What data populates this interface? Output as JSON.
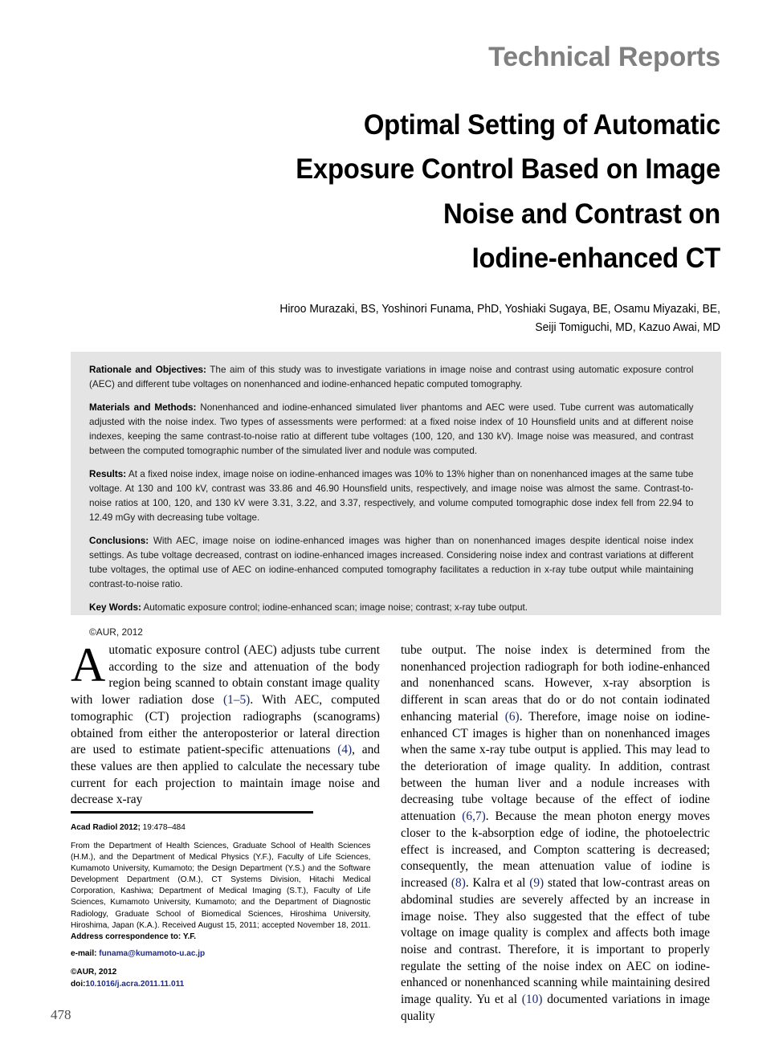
{
  "header": {
    "section_label": "Technical Reports"
  },
  "title": {
    "lines": [
      "Optimal Setting of Automatic",
      "Exposure Control Based on Image",
      "Noise and Contrast on",
      "Iodine-enhanced CT"
    ],
    "full": "Optimal Setting of Automatic Exposure Control Based on Image Noise and Contrast on Iodine-enhanced CT"
  },
  "authors": {
    "line1": "Hiroo Murazaki, BS, Yoshinori Funama, PhD, Yoshiaki Sugaya, BE, Osamu Miyazaki, BE,",
    "line2": "Seiji Tomiguchi, MD, Kazuo Awai, MD"
  },
  "abstract": {
    "rationale_label": "Rationale and Objectives:",
    "rationale_text": " The aim of this study was to investigate variations in image noise and contrast using automatic exposure control (AEC) and different tube voltages on nonenhanced and iodine-enhanced hepatic computed tomography.",
    "methods_label": "Materials and Methods:",
    "methods_text": " Nonenhanced and iodine-enhanced simulated liver phantoms and AEC were used. Tube current was automatically adjusted with the noise index. Two types of assessments were performed: at a fixed noise index of 10 Hounsfield units and at different noise indexes, keeping the same contrast-to-noise ratio at different tube voltages (100, 120, and 130 kV). Image noise was measured, and contrast between the computed tomographic number of the simulated liver and nodule was computed.",
    "results_label": "Results:",
    "results_text": " At a fixed noise index, image noise on iodine-enhanced images was 10% to 13% higher than on nonenhanced images at the same tube voltage. At 130 and 100 kV, contrast was 33.86 and 46.90 Hounsfield units, respectively, and image noise was almost the same. Contrast-to-noise ratios at 100, 120, and 130 kV were 3.31, 3.22, and 3.37, respectively, and volume computed tomographic dose index fell from 22.94 to 12.49 mGy with decreasing tube voltage.",
    "conclusions_label": "Conclusions:",
    "conclusions_text": " With AEC, image noise on iodine-enhanced images was higher than on nonenhanced images despite identical noise index settings. As tube voltage decreased, contrast on iodine-enhanced images increased. Considering noise index and contrast variations at different tube voltages, the optimal use of AEC on iodine-enhanced computed tomography facilitates a reduction in x-ray tube output while maintaining contrast-to-noise ratio.",
    "keywords_label": "Key Words:",
    "keywords_text": " Automatic exposure control; iodine-enhanced scan; image noise; contrast; x-ray tube output.",
    "copyright": "©AUR, 2012"
  },
  "body": {
    "left_dropcap": "A",
    "left_paragraph": "utomatic exposure control (AEC) adjusts tube current according to the size and attenuation of the body region being scanned to obtain constant image quality with lower radiation dose ",
    "left_ref1": "(1–5)",
    "left_paragraph_2": ". With AEC, computed tomographic (CT) projection radiographs (scanograms) obtained from either the anteroposterior or lateral direction are used to estimate patient-specific attenuations ",
    "left_ref2": "(4)",
    "left_paragraph_3": ", and these values are then applied to calculate the necessary tube current for each projection to maintain image noise and decrease x-ray",
    "right_p1": "tube output. The noise index is determined from the nonenhanced projection radiograph for both iodine-enhanced and nonenhanced scans. However, x-ray absorption is different in scan areas that do or do not contain iodinated enhancing material ",
    "right_ref1": "(6)",
    "right_p2": ". Therefore, image noise on iodine-enhanced CT images is higher than on nonenhanced images when the same x-ray tube output is applied. This may lead to the deterioration of image quality. In addition, contrast between the human liver and a nodule increases with decreasing tube voltage because of the effect of iodine attenuation ",
    "right_ref2": "(6,7)",
    "right_p3": ". Because the mean photon energy moves closer to the k-absorption edge of iodine, the photoelectric effect is increased, and Compton scattering is decreased; consequently, the mean attenuation value of iodine is increased ",
    "right_ref3": "(8)",
    "right_p4": ". Kalra et al ",
    "right_ref4": "(9)",
    "right_p5": " stated that low-contrast areas on abdominal studies are severely affected by an increase in image noise. They also suggested that the effect of tube voltage on image quality is complex and affects both image noise and contrast. Therefore, it is important to properly regulate the setting of the noise index on AEC on iodine-enhanced or nonenhanced scanning while maintaining desired image quality. Yu et al ",
    "right_ref5": "(10)",
    "right_p6": " documented variations in image quality"
  },
  "footnote": {
    "citation_bold": "Acad Radiol 2012;",
    "citation_rest": " 19:478–484",
    "affiliation": "From the Department of Health Sciences, Graduate School of Health Sciences (H.M.), and the Department of Medical Physics (Y.F.), Faculty of Life Sciences, Kumamoto University, Kumamoto; the Design Department (Y.S.) and the Software Development Department (O.M.), CT Systems Division, Hitachi Medical Corporation, Kashiwa; Department of Medical Imaging (S.T.), Faculty of Life Sciences, Kumamoto University, Kumamoto; and the Department of Diagnostic Radiology, Graduate School of Biomedical Sciences, Hiroshima University, Hiroshima, Japan (K.A.). Received August 15, 2011; accepted November 18, 2011. ",
    "correspondence_bold": "Address correspondence to:",
    "correspondence_rest": " Y.F.",
    "email_label": "e-mail: ",
    "email_value": "funama@kumamoto-u.ac.jp",
    "aur_copyright": "©AUR, 2012",
    "doi_label": "doi:",
    "doi_value": "10.1016/j.acra.2011.11.011"
  },
  "page": {
    "number": "478"
  },
  "colors": {
    "header_gray": "#808080",
    "abstract_bg": "#e4e4e4",
    "link_blue": "#1c2a8e",
    "ref_blue": "#1c2a6e",
    "page_number_gray": "#4d4d4d"
  }
}
